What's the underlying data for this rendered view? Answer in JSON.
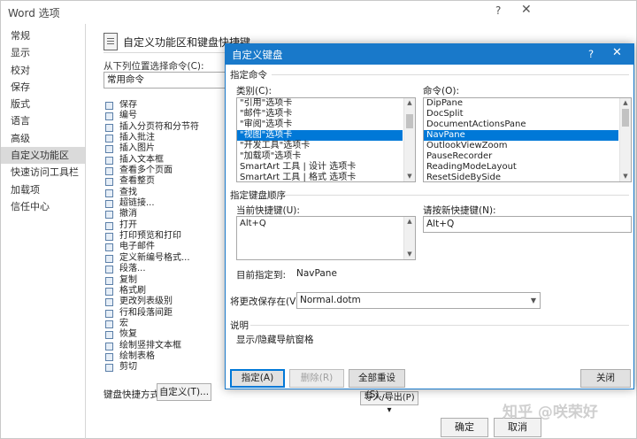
{
  "back_window": {
    "title": "Word 选项",
    "help": "?",
    "close": "✕",
    "nav": [
      "常规",
      "显示",
      "校对",
      "保存",
      "版式",
      "语言",
      "高级",
      "自定义功能区",
      "快速访问工具栏",
      "加载项",
      "信任中心"
    ],
    "header_title": "自定义功能区和键盘快捷键。",
    "choose_label": "从下列位置选择命令(C):",
    "choose_value": "常用命令",
    "commands": [
      "保存",
      "编号",
      "插入分页符和分节符",
      "插入批注",
      "插入图片",
      "插入文本框",
      "查看多个页面",
      "查看整页",
      "查找",
      "超链接...",
      "撤消",
      "打开",
      "打印预览和打印",
      "电子邮件",
      "定义新编号格式...",
      "段落...",
      "复制",
      "格式刷",
      "更改列表级别",
      "行和段落间距",
      "宏",
      "恢复",
      "绘制竖排文本框",
      "绘制表格",
      "剪切"
    ],
    "shortcut_label": "键盘快捷方式:",
    "customize_button": "自定义(T)...",
    "import_export": "导入/导出(P) ▾",
    "ok": "确定",
    "cancel": "取消",
    "watermark": "知乎 @咲荣好"
  },
  "dialog": {
    "title": "自定义键盘",
    "help": "?",
    "close": "✕",
    "specify_command": "指定命令",
    "categories_label": "类别(C):",
    "categories": [
      "\"引用\"选项卡",
      "\"邮件\"选项卡",
      "\"审阅\"选项卡",
      "\"视图\"选项卡",
      "\"开发工具\"选项卡",
      "\"加载项\"选项卡",
      "SmartArt 工具 | 设计 选项卡",
      "SmartArt 工具 | 格式 选项卡"
    ],
    "categories_selected_index": 3,
    "commands_label": "命令(O):",
    "commands": [
      "DipPane",
      "DocSplit",
      "DocumentActionsPane",
      "NavPane",
      "OutlookViewZoom",
      "PauseRecorder",
      "ReadingModeLayout",
      "ResetSideBySide"
    ],
    "commands_selected_index": 3,
    "key_sequence": "指定键盘顺序",
    "current_keys_label": "当前快捷键(U):",
    "current_keys": [
      "Alt+Q"
    ],
    "new_key_label": "请按新快捷键(N):",
    "new_key_value": "Alt+Q",
    "assigned_to_label": "目前指定到:",
    "assigned_to_value": "NavPane",
    "save_in_label": "将更改保存在(V):",
    "save_in_value": "Normal.dotm",
    "description_label": "说明",
    "description_text": "显示/隐藏导航窗格",
    "assign_button": "指定(A)",
    "remove_button": "删除(R)",
    "reset_all_button": "全部重设(S)...",
    "close_button": "关闭"
  }
}
